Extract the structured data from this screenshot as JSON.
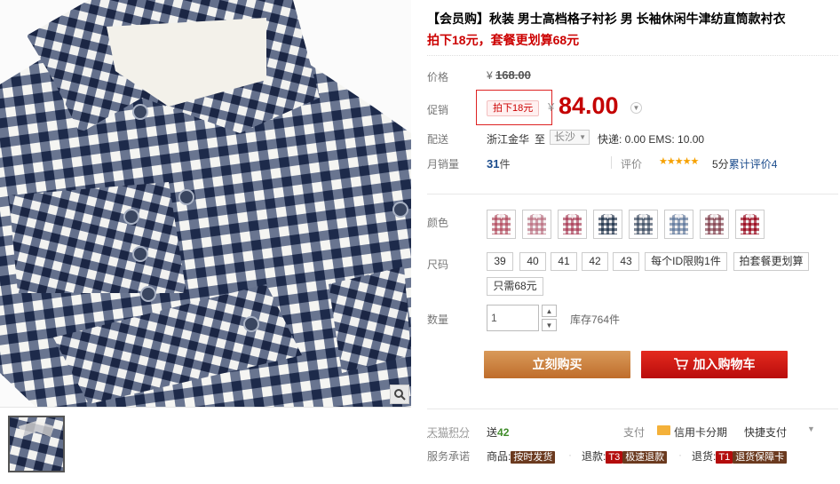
{
  "product": {
    "title": "【会员购】秋装 男士高档格子衬衫 男 长袖休闲牛津纺直筒款衬衣",
    "subtitle": "拍下18元，套餐更划算68元"
  },
  "price": {
    "label": "价格",
    "currency": "¥",
    "original": "168.00"
  },
  "promo": {
    "label": "促销",
    "tag": "拍下18元",
    "currency": "¥",
    "price": "84.00"
  },
  "shipping": {
    "label": "配送",
    "from": "浙江金华",
    "to_label": "至",
    "city": "长沙",
    "cost": "快递: 0.00 EMS: 10.00"
  },
  "sales": {
    "label": "月销量",
    "count": "31",
    "unit": "件",
    "rating_label": "评价",
    "stars": "★★★★★",
    "score": "5分",
    "reviews_link": "累计评价4"
  },
  "color": {
    "label": "颜色",
    "swatches": [
      {
        "name": "pink-plaid",
        "color": "#b8586a"
      },
      {
        "name": "light-pink-plaid",
        "color": "#c07a8a"
      },
      {
        "name": "rose-check",
        "color": "#b04a62"
      },
      {
        "name": "black-check",
        "color": "#2d3f55"
      },
      {
        "name": "grey-blue-check",
        "color": "#4b5a6e"
      },
      {
        "name": "blue-check",
        "color": "#6980a2"
      },
      {
        "name": "mauve-check",
        "color": "#8a4c58"
      },
      {
        "name": "red-check",
        "color": "#9e1226"
      }
    ]
  },
  "size": {
    "label": "尺码",
    "options": [
      "39",
      "40",
      "41",
      "42",
      "43",
      "每个ID限购1件",
      "拍套餐更划算",
      "只需68元"
    ]
  },
  "quantity": {
    "label": "数量",
    "value": "1",
    "stock": "库存764件"
  },
  "actions": {
    "buy_now": "立刻购买",
    "add_to_cart": "加入购物车"
  },
  "points": {
    "label": "天猫积分",
    "prefix": "送",
    "value": "42",
    "pay_label": "支付",
    "credit": "信用卡分期",
    "quick_pay": "快捷支付"
  },
  "service": {
    "label": "服务承诺",
    "goods_label": "商品:",
    "goods_badge": "按时发货",
    "refund_label": "退款:",
    "refund_code": "T3",
    "refund_badge": "极速退款",
    "return_label": "退货:",
    "return_code": "T1",
    "return_badge": "退货保障卡"
  },
  "colors": {
    "promo_red": "#c40000",
    "buy_orange": "#c97a3c",
    "cart_red": "#d01a12",
    "link_blue": "#1a4b8c",
    "star_orange": "#f6a100"
  }
}
